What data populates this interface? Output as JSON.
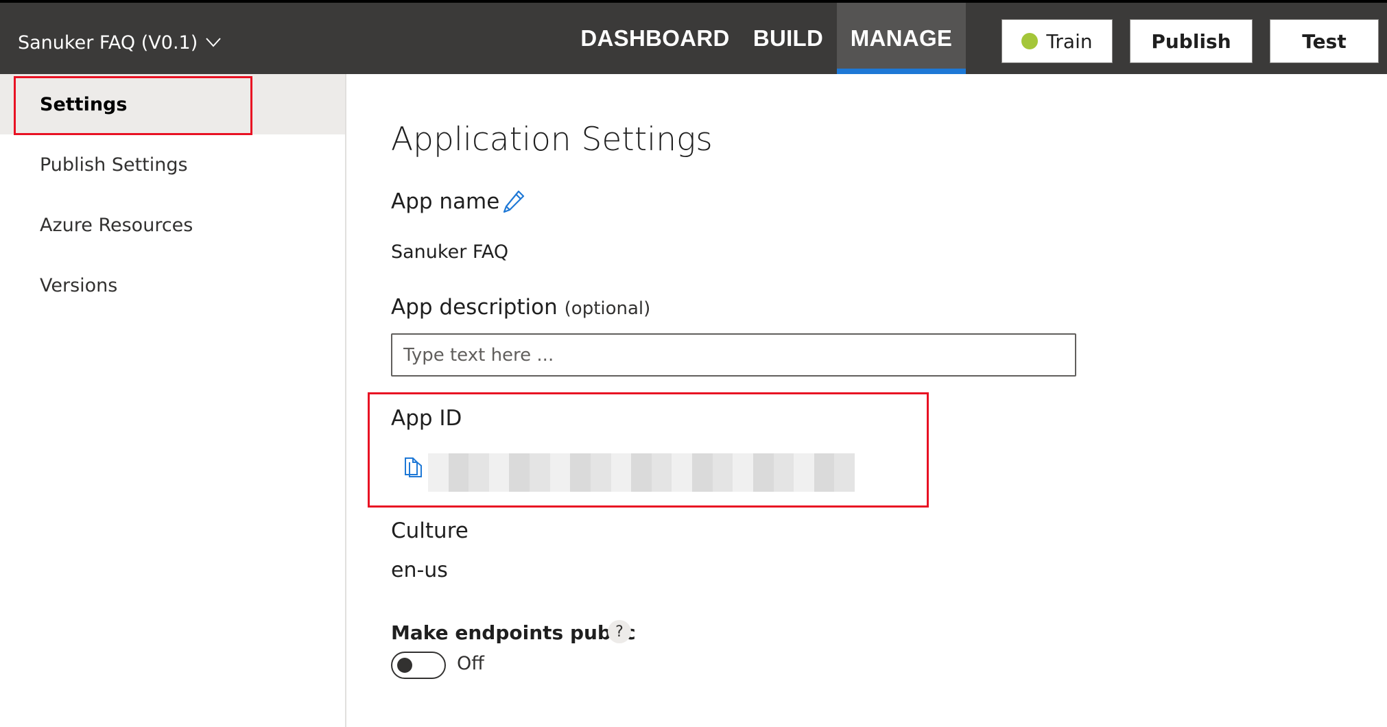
{
  "header": {
    "app_title": "Sanuker FAQ (V0.1)",
    "nav": [
      {
        "label": "DASHBOARD",
        "active": false
      },
      {
        "label": "BUILD",
        "active": false
      },
      {
        "label": "MANAGE",
        "active": true
      }
    ],
    "buttons": {
      "train": "Train",
      "publish": "Publish",
      "test": "Test"
    },
    "train_status_color": "#a4c639",
    "active_underline_color": "#1e78d6"
  },
  "sidebar": {
    "items": [
      {
        "label": "Settings",
        "active": true
      },
      {
        "label": "Publish Settings",
        "active": false
      },
      {
        "label": "Azure Resources",
        "active": false
      },
      {
        "label": "Versions",
        "active": false
      }
    ]
  },
  "main": {
    "title": "Application Settings",
    "app_name": {
      "label": "App name",
      "value": "Sanuker FAQ"
    },
    "app_description": {
      "label": "App description",
      "optional": "(optional)",
      "placeholder": "Type text here ...",
      "value": ""
    },
    "app_id": {
      "label": "App ID",
      "value_redacted": true
    },
    "culture": {
      "label": "Culture",
      "value": "en-us"
    },
    "endpoints": {
      "label": "Make endpoints public",
      "help": "?",
      "toggle_state": "Off"
    }
  },
  "highlight_color": "#e81123",
  "icons": {
    "dropdown": "chevron-down-icon",
    "edit": "pencil-icon",
    "copy": "copy-icon",
    "help": "help-icon"
  }
}
